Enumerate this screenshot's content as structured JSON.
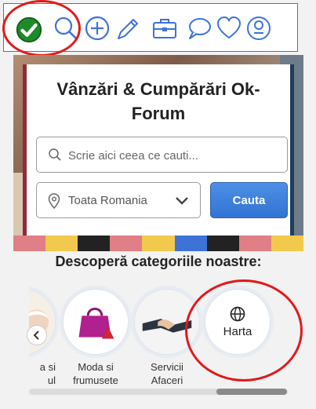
{
  "toolbar": {
    "icons": [
      "check-icon",
      "search-icon",
      "plus-icon",
      "pencil-icon",
      "briefcase-icon",
      "chat-icon",
      "heart-icon",
      "profile-icon"
    ],
    "accent": "#3d73d6",
    "check_color": "#1f8a2a"
  },
  "hero": {
    "title": "Vânzări & Cumpărări Ok-Forum",
    "search_placeholder": "Scrie aici ceea ce cauti...",
    "location_value": "Toata Romania",
    "search_button": "Cauta"
  },
  "categories": {
    "title": "Descoperă categoriile noastre:",
    "items": [
      {
        "label": "a si\nul",
        "icon": "person-photo"
      },
      {
        "label": "Moda si\nfrumusete",
        "icon": "handbag-photo"
      },
      {
        "label": "Servicii\nAfaceri",
        "icon": "handshake-photo"
      },
      {
        "label": "Harta",
        "icon": "globe-icon"
      }
    ]
  },
  "annotation_color": "#e01a1a",
  "button_color": "#3173d2"
}
